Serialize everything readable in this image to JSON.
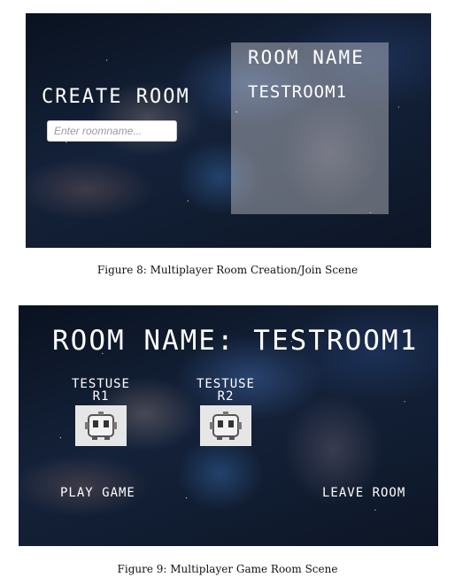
{
  "figure8": {
    "create_room_label": "CREATE ROOM",
    "input_placeholder": "Enter roomname...",
    "room_list_header": "ROOM NAME",
    "rooms": [
      "TESTROOM1"
    ],
    "caption": "Figure 8: Multiplayer Room Creation/Join Scene"
  },
  "figure9": {
    "room_title": "ROOM NAME: TESTROOM1",
    "players": [
      {
        "name": "TESTUSER1",
        "avatar": "robot-avatar-icon"
      },
      {
        "name": "TESTUSER2",
        "avatar": "robot-avatar-icon"
      }
    ],
    "play_button": "PLAY GAME",
    "leave_button": "LEAVE ROOM",
    "caption": "Figure 9: Multiplayer Game Room Scene"
  }
}
